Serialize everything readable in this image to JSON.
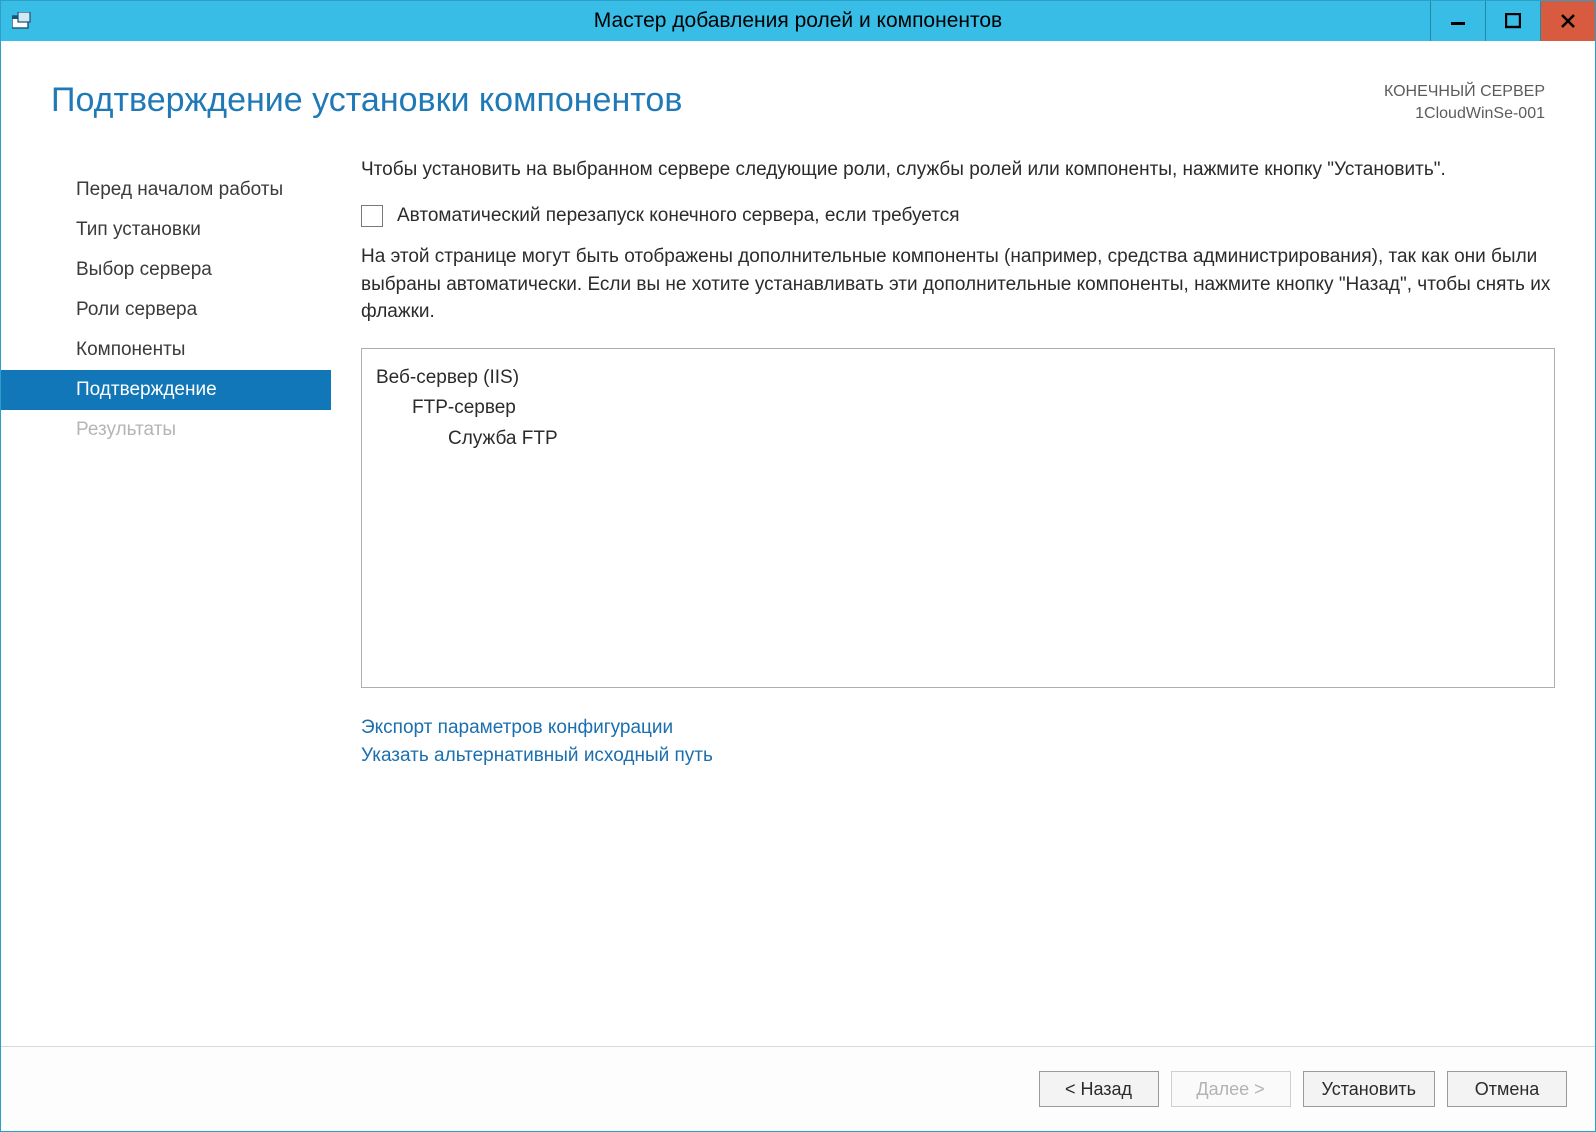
{
  "window": {
    "title": "Мастер добавления ролей и компонентов"
  },
  "header": {
    "page_title": "Подтверждение установки компонентов",
    "server_label": "КОНЕЧНЫЙ СЕРВЕР",
    "server_name": "1CloudWinSe-001"
  },
  "sidebar": {
    "items": [
      {
        "label": "Перед началом работы",
        "state": "normal"
      },
      {
        "label": "Тип установки",
        "state": "normal"
      },
      {
        "label": "Выбор сервера",
        "state": "normal"
      },
      {
        "label": "Роли сервера",
        "state": "normal"
      },
      {
        "label": "Компоненты",
        "state": "normal"
      },
      {
        "label": "Подтверждение",
        "state": "active"
      },
      {
        "label": "Результаты",
        "state": "disabled"
      }
    ]
  },
  "main": {
    "intro": "Чтобы установить на выбранном сервере следующие роли, службы ролей или компоненты, нажмите кнопку \"Установить\".",
    "checkbox_label": "Автоматический перезапуск конечного сервера, если требуется",
    "checkbox_checked": false,
    "note": "На этой странице могут быть отображены дополнительные компоненты (например, средства администрирования), так как они были выбраны автоматически. Если вы не хотите устанавливать эти дополнительные компоненты, нажмите кнопку \"Назад\", чтобы снять их флажки.",
    "listbox": [
      {
        "text": "Веб-сервер (IIS)",
        "indent": 0
      },
      {
        "text": "FTP-сервер",
        "indent": 1
      },
      {
        "text": "Служба FTP",
        "indent": 2
      }
    ],
    "links": {
      "export_config": "Экспорт параметров конфигурации",
      "alt_source": "Указать альтернативный исходный путь"
    }
  },
  "footer": {
    "back": "< Назад",
    "next": "Далее >",
    "install": "Установить",
    "cancel": "Отмена"
  }
}
